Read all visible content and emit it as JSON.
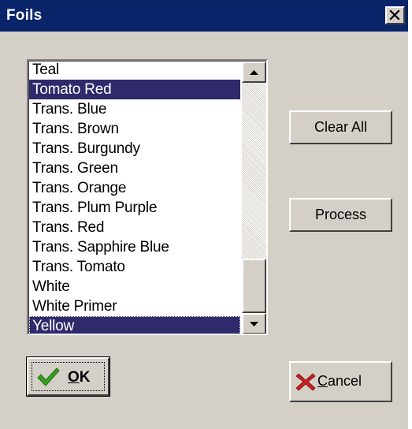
{
  "window": {
    "title": "Foils",
    "close_glyph": "✕"
  },
  "list": {
    "items": [
      {
        "label": "Teal",
        "selected": false
      },
      {
        "label": "Tomato Red",
        "selected": true
      },
      {
        "label": "Trans. Blue",
        "selected": false
      },
      {
        "label": "Trans. Brown",
        "selected": false
      },
      {
        "label": "Trans. Burgundy",
        "selected": false
      },
      {
        "label": "Trans. Green",
        "selected": false
      },
      {
        "label": "Trans. Orange",
        "selected": false
      },
      {
        "label": "Trans. Plum Purple",
        "selected": false
      },
      {
        "label": "Trans. Red",
        "selected": false
      },
      {
        "label": "Trans. Sapphire Blue",
        "selected": false
      },
      {
        "label": "Trans. Tomato",
        "selected": false
      },
      {
        "label": "White",
        "selected": false
      },
      {
        "label": "White Primer",
        "selected": false
      },
      {
        "label": "Yellow",
        "selected": true
      }
    ],
    "selection_color": "#2e2a6b"
  },
  "buttons": {
    "clear_all": "Clear All",
    "process": "Process",
    "ok": "OK",
    "cancel": "Cancel"
  },
  "colors": {
    "title_bar": "#0a246a",
    "dialog_face": "#d4d0c8",
    "ok_check": "#3aa01e",
    "cancel_x": "#c8201c"
  }
}
